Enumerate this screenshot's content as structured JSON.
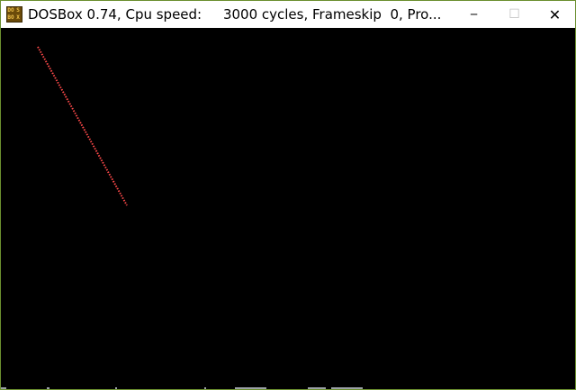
{
  "window": {
    "title": "DOSBox 0.74, Cpu speed:     3000 cycles, Frameskip  0, Pro...",
    "icon": "dosbox-icon",
    "icon_letters": [
      "DO",
      "S",
      "BO",
      "X"
    ],
    "controls": {
      "minimize": "─",
      "maximize": "☐",
      "close": "✕"
    }
  },
  "screen": {
    "background": "#000000",
    "line_color": "#ff4a4a"
  }
}
